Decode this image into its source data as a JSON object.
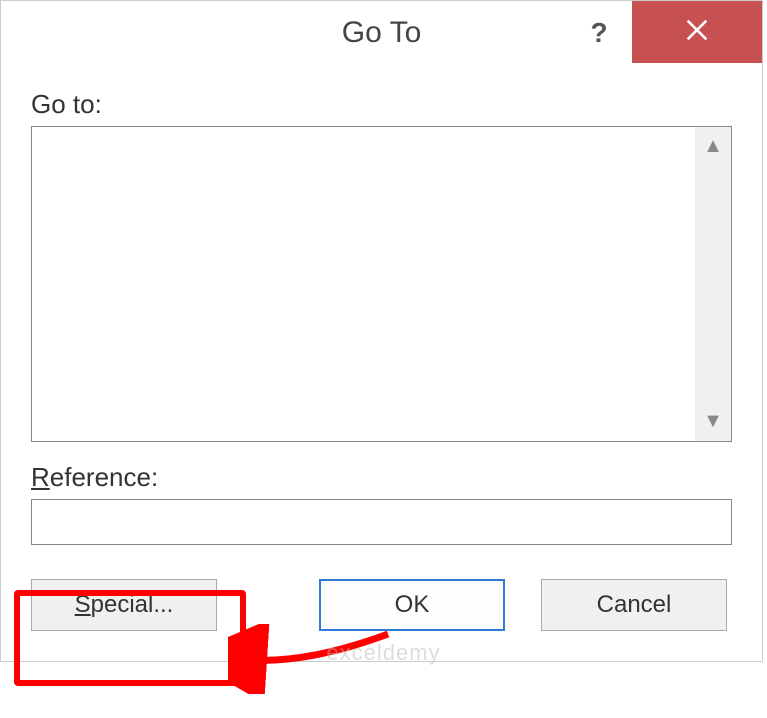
{
  "dialog": {
    "title": "Go To",
    "help_tooltip": "?",
    "close_tooltip": "Close"
  },
  "labels": {
    "goto": "Go to:",
    "reference": "Reference:"
  },
  "listbox": {
    "items": []
  },
  "reference": {
    "value": ""
  },
  "buttons": {
    "special": "Special...",
    "ok": "OK",
    "cancel": "Cancel"
  },
  "watermark": "exceldemy"
}
